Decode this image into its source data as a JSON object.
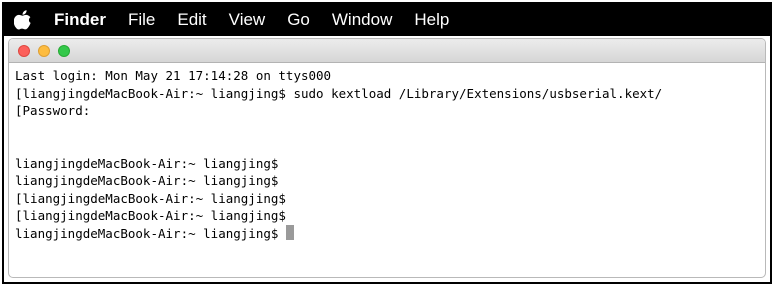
{
  "menubar": {
    "apple_icon": "apple-icon",
    "app_name": "Finder",
    "items": [
      "File",
      "Edit",
      "View",
      "Go",
      "Window",
      "Help"
    ]
  },
  "window": {
    "traffic_lights": {
      "close": "#fc605b",
      "minimize": "#fdbc40",
      "zoom": "#34c84a"
    }
  },
  "terminal": {
    "lines": [
      "Last login: Mon May 21 17:14:28 on ttys000",
      "[liangjingdeMacBook-Air:~ liangjing$ sudo kextload /Library/Extensions/usbserial.kext/",
      "[Password:",
      "",
      "",
      "liangjingdeMacBook-Air:~ liangjing$",
      "liangjingdeMacBook-Air:~ liangjing$",
      "[liangjingdeMacBook-Air:~ liangjing$",
      "[liangjingdeMacBook-Air:~ liangjing$",
      "liangjingdeMacBook-Air:~ liangjing$"
    ]
  }
}
